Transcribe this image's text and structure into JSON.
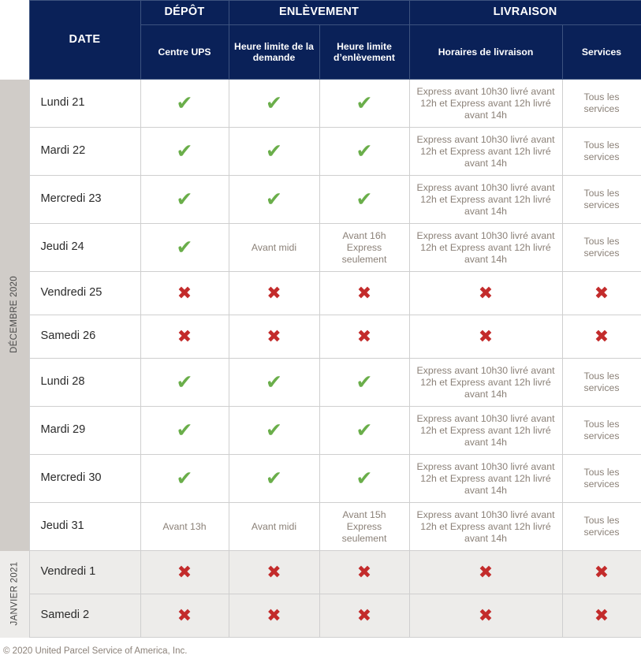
{
  "colors": {
    "header_navy": "#0a2158",
    "rail_gray": "#d0ccc8",
    "check_green": "#6aae4a",
    "cross_red": "#c32b2b",
    "jan_row_bg": "#edecea",
    "body_text": "#8b8178"
  },
  "header": {
    "date_label": "DATE",
    "groups": [
      {
        "label": "DÉPÔT",
        "span": 1
      },
      {
        "label": "ENLÈVEMENT",
        "span": 2
      },
      {
        "label": "LIVRAISON",
        "span": 2
      }
    ],
    "columns": [
      "Centre UPS",
      "Heure limite de la demande",
      "Heure limite d’enlèvement",
      "Horaires de livraison",
      "Services"
    ]
  },
  "months": [
    {
      "label": "DÉCEMBRE 2020",
      "rows": 10
    },
    {
      "label": "JANVIER 2021",
      "rows": 2
    }
  ],
  "icons": {
    "yes": "✔",
    "no": "✖",
    "yes_name": "check-icon",
    "no_name": "cross-icon"
  },
  "common": {
    "delivery_standard": "Express avant 10h30 livré avant 12h et Express avant 12h livré avant 14h",
    "services_all": "Tous les services",
    "avant_midi": "Avant midi",
    "avant_13h": "Avant 13h",
    "avant_16h_express": "Avant 16h Express seulement",
    "avant_15h_express": "Avant 15h Express seulement"
  },
  "rows": [
    {
      "month": "decembre",
      "date": "Lundi 21",
      "centre_ups": {
        "type": "yes"
      },
      "heure_demande": {
        "type": "yes"
      },
      "heure_enlevement": {
        "type": "yes"
      },
      "horaires": {
        "type": "text",
        "text": "Express avant 10h30 livré avant 12h et Express avant 12h livré avant 14h"
      },
      "services": {
        "type": "text",
        "text": "Tous les services"
      }
    },
    {
      "month": "decembre",
      "date": "Mardi 22",
      "centre_ups": {
        "type": "yes"
      },
      "heure_demande": {
        "type": "yes"
      },
      "heure_enlevement": {
        "type": "yes"
      },
      "horaires": {
        "type": "text",
        "text": "Express avant 10h30 livré avant 12h et Express avant 12h livré avant 14h"
      },
      "services": {
        "type": "text",
        "text": "Tous les services"
      }
    },
    {
      "month": "decembre",
      "date": "Mercredi 23",
      "centre_ups": {
        "type": "yes"
      },
      "heure_demande": {
        "type": "yes"
      },
      "heure_enlevement": {
        "type": "yes"
      },
      "horaires": {
        "type": "text",
        "text": "Express avant 10h30 livré avant 12h et Express avant 12h livré avant 14h"
      },
      "services": {
        "type": "text",
        "text": "Tous les services"
      }
    },
    {
      "month": "decembre",
      "date": "Jeudi 24",
      "centre_ups": {
        "type": "yes"
      },
      "heure_demande": {
        "type": "text",
        "text": "Avant midi"
      },
      "heure_enlevement": {
        "type": "text",
        "text": "Avant 16h Express seulement"
      },
      "horaires": {
        "type": "text",
        "text": "Express avant 10h30 livré avant 12h et Express avant 12h livré avant 14h"
      },
      "services": {
        "type": "text",
        "text": "Tous les services"
      }
    },
    {
      "month": "decembre",
      "date": "Vendredi 25",
      "centre_ups": {
        "type": "no"
      },
      "heure_demande": {
        "type": "no"
      },
      "heure_enlevement": {
        "type": "no"
      },
      "horaires": {
        "type": "no"
      },
      "services": {
        "type": "no"
      }
    },
    {
      "month": "decembre",
      "date": "Samedi 26",
      "centre_ups": {
        "type": "no"
      },
      "heure_demande": {
        "type": "no"
      },
      "heure_enlevement": {
        "type": "no"
      },
      "horaires": {
        "type": "no"
      },
      "services": {
        "type": "no"
      }
    },
    {
      "month": "decembre",
      "date": "Lundi 28",
      "centre_ups": {
        "type": "yes"
      },
      "heure_demande": {
        "type": "yes"
      },
      "heure_enlevement": {
        "type": "yes"
      },
      "horaires": {
        "type": "text",
        "text": "Express avant 10h30 livré avant 12h et Express avant 12h livré avant 14h"
      },
      "services": {
        "type": "text",
        "text": "Tous les services"
      }
    },
    {
      "month": "decembre",
      "date": "Mardi 29",
      "centre_ups": {
        "type": "yes"
      },
      "heure_demande": {
        "type": "yes"
      },
      "heure_enlevement": {
        "type": "yes"
      },
      "horaires": {
        "type": "text",
        "text": "Express avant 10h30 livré avant 12h et Express avant 12h livré avant 14h"
      },
      "services": {
        "type": "text",
        "text": "Tous les services"
      }
    },
    {
      "month": "decembre",
      "date": "Mercredi 30",
      "centre_ups": {
        "type": "yes"
      },
      "heure_demande": {
        "type": "yes"
      },
      "heure_enlevement": {
        "type": "yes"
      },
      "horaires": {
        "type": "text",
        "text": "Express avant 10h30 livré avant 12h et Express avant 12h livré avant 14h"
      },
      "services": {
        "type": "text",
        "text": "Tous les services"
      }
    },
    {
      "month": "decembre",
      "date": "Jeudi 31",
      "centre_ups": {
        "type": "text",
        "text": "Avant 13h"
      },
      "heure_demande": {
        "type": "text",
        "text": "Avant midi"
      },
      "heure_enlevement": {
        "type": "text",
        "text": "Avant 15h Express seulement"
      },
      "horaires": {
        "type": "text",
        "text": "Express avant 10h30 livré avant 12h et Express avant 12h livré avant 14h"
      },
      "services": {
        "type": "text",
        "text": "Tous les services"
      }
    },
    {
      "month": "janvier",
      "date": "Vendredi 1",
      "centre_ups": {
        "type": "no"
      },
      "heure_demande": {
        "type": "no"
      },
      "heure_enlevement": {
        "type": "no"
      },
      "horaires": {
        "type": "no"
      },
      "services": {
        "type": "no"
      }
    },
    {
      "month": "janvier",
      "date": "Samedi 2",
      "centre_ups": {
        "type": "no"
      },
      "heure_demande": {
        "type": "no"
      },
      "heure_enlevement": {
        "type": "no"
      },
      "horaires": {
        "type": "no"
      },
      "services": {
        "type": "no"
      }
    }
  ],
  "footer": {
    "copyright": "© 2020 United Parcel Service of America, Inc."
  }
}
